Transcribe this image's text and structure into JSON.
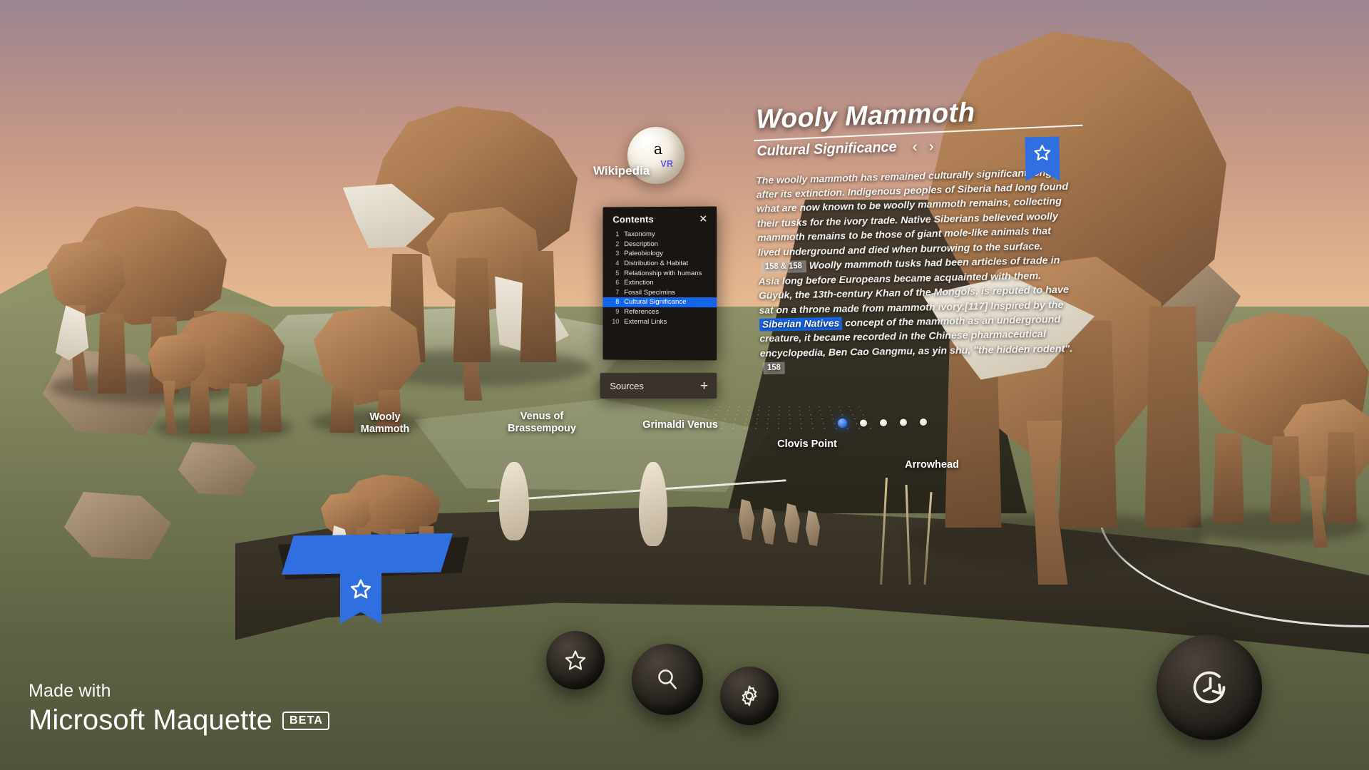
{
  "app": {
    "brand_made_with": "Made with",
    "brand_name": "Microsoft Maquette",
    "brand_badge": "BETA"
  },
  "wikipedia_orb": {
    "label": "Wikipedia",
    "glyph": "a",
    "vr_tag": "VR"
  },
  "contents_panel": {
    "title": "Contents",
    "close_label": "✕",
    "active_index": 8,
    "items": [
      {
        "num": "1",
        "label": "Taxonomy"
      },
      {
        "num": "2",
        "label": "Description"
      },
      {
        "num": "3",
        "label": "Paleobiology"
      },
      {
        "num": "4",
        "label": "Distribution & Habitat"
      },
      {
        "num": "5",
        "label": "Relationship with humans"
      },
      {
        "num": "6",
        "label": "Extinction"
      },
      {
        "num": "7",
        "label": "Fossil Specimins"
      },
      {
        "num": "8",
        "label": "Cultural Significance"
      },
      {
        "num": "9",
        "label": "References"
      },
      {
        "num": "10",
        "label": "External Links"
      }
    ]
  },
  "sources_panel": {
    "label": "Sources",
    "add_label": "+"
  },
  "article": {
    "title": "Wooly Mammoth",
    "section": "Cultural Significance",
    "prev_label": "‹",
    "next_label": "›",
    "body_part_1": "The woolly mammoth has remained culturally significant long after its extinction. Indigenous peoples of Siberia had long found what are now known to be woolly mammoth remains, collecting their tusks for the ivory trade. Native Siberians believed woolly mammoth remains to be those of giant mole-like animals that lived underground and died when burrowing to the surface.",
    "citation_1": "158 & 158",
    "body_part_2": "Woolly mammoth tusks had been articles of trade in Asia long before Europeans became acquainted with them. Güyük, the 13th-century Khan of the Mongols, is reputed to have sat on a throne made from mammoth ivory.[117] Inspired by the",
    "highlighted_term": "Siberian Natives",
    "body_part_3": "concept of the mammoth as an underground creature, it became recorded in the Chinese pharmaceutical encyclopedia, Ben Cao Gangmu, as yin shu, \"the hidden rodent\".",
    "citation_2": "158",
    "pagination": {
      "total": 5,
      "active": 1
    }
  },
  "scene_labels": [
    {
      "name": "wooly-mammoth",
      "text": "Wooly\nMammoth"
    },
    {
      "name": "venus-brassempouy",
      "text": "Venus of\nBrassempouy"
    },
    {
      "name": "grimaldi-venus",
      "text": "Grimaldi Venus"
    },
    {
      "name": "clovis-point",
      "text": "Clovis Point"
    },
    {
      "name": "arrowhead",
      "text": "Arrowhead"
    }
  ],
  "toolbar": {
    "bookmark_label": "Bookmark",
    "search_label": "Search",
    "settings_label": "Settings",
    "history_label": "History"
  },
  "colors": {
    "accent_blue": "#2f6fe0",
    "highlight_blue": "#1565e8",
    "panel_dark": "#1a1512",
    "sources_bg": "#3a332c",
    "text_white": "#ffffff",
    "mammoth_brown": "#a9794f",
    "ground_green": "#6f7350",
    "sky_top": "#9b8591",
    "sky_bottom": "#f2cc9d"
  }
}
